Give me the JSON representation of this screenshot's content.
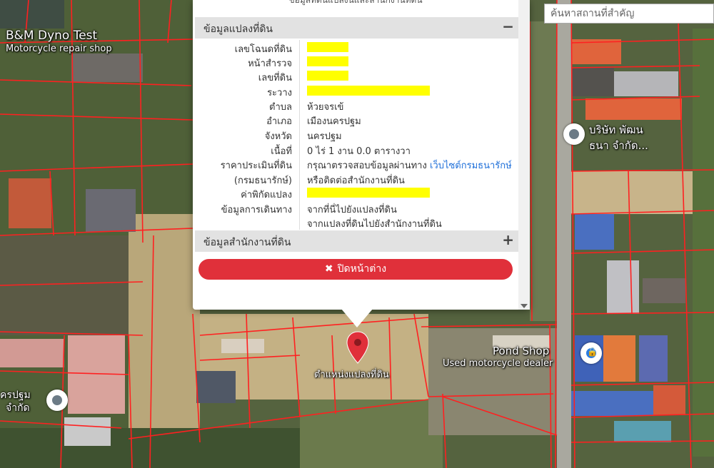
{
  "search": {
    "placeholder": "ค้นหาสถานที่สำคัญ"
  },
  "map_labels": {
    "bm_dyno_name": "B&M Dyno Test",
    "bm_dyno_type": "Motorcycle repair shop",
    "company_top_line1": "บริษัท พัฒน",
    "company_top_line2": "ธนา จำกัด...",
    "pond_shop_name": "Pond Shop",
    "pond_shop_type": "Used motorcycle dealer",
    "left_line1": "ครปฐม",
    "left_line2": "จำกัด",
    "pin_label": "ตำแหน่งแปลงที่ดิน"
  },
  "popup": {
    "cut_title": "ข้อมูลที่ดินแปลงนี้และสำนักงานที่ดิน",
    "section1": {
      "title": "ข้อมูลแปลงที่ดิน",
      "toggle": "−"
    },
    "rows": {
      "deed_no": {
        "label": "เลขโฉนดที่ดิน"
      },
      "survey_page": {
        "label": "หน้าสำรวจ"
      },
      "parcel_no": {
        "label": "เลขที่ดิน"
      },
      "map_sheet": {
        "label": "ระวาง"
      },
      "subdistrict": {
        "label": "ตำบล",
        "value": "ห้วยจรเข้"
      },
      "district": {
        "label": "อำเภอ",
        "value": "เมืองนครปฐม"
      },
      "province": {
        "label": "จังหวัด",
        "value": "นครปฐม"
      },
      "area": {
        "label": "เนื้อที่",
        "value": "0 ไร่ 1 งาน 0.0 ตารางวา"
      },
      "appraisal": {
        "label": "ราคาประเมินที่ดิน",
        "value_text": "กรุณาตรวจสอบข้อมูลผ่านทาง",
        "value_link": "เว็บไซต์กรมธนารักษ์"
      },
      "appraisal2": {
        "label": "(กรมธนารักษ์)",
        "value": "หรือติดต่อสำนักงานที่ดิน"
      },
      "coords": {
        "label": "ค่าพิกัดแปลง"
      },
      "travel": {
        "label": "ข้อมูลการเดินทาง",
        "link1": "จากที่นี่ไปยังแปลงที่ดิน",
        "link2": "จากแปลงที่ดินไปยังสำนักงานที่ดิน"
      }
    },
    "section2": {
      "title": "ข้อมูลสำนักงานที่ดิน",
      "toggle": "+"
    },
    "close_button": {
      "icon": "✖",
      "label": "ปิดหน้าต่าง"
    }
  },
  "colors": {
    "parcel_lines": "#ff2020",
    "close_button": "#e0303a",
    "pin": "#e0303a",
    "redaction": "#ffff00",
    "link": "#1e6fd9"
  }
}
